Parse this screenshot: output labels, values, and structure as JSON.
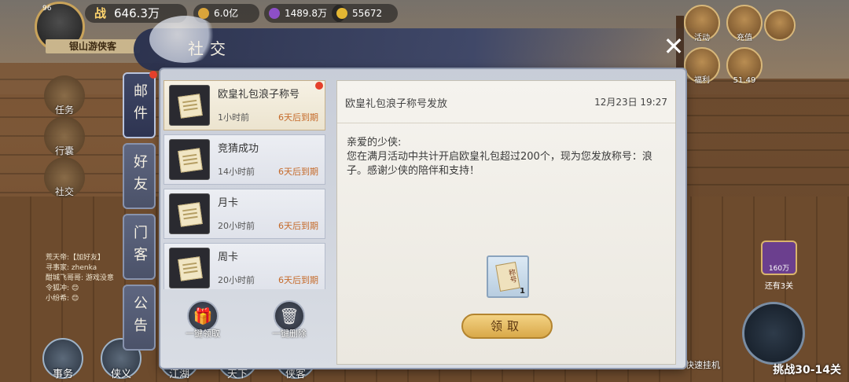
{
  "player": {
    "level": "96",
    "name": "银山游侠客",
    "power_prefix": "战",
    "power": "646.3万"
  },
  "currencies": [
    {
      "icon": "coin-icon",
      "value": "6.0亿",
      "color": "#d9a43a"
    },
    {
      "icon": "gem-icon",
      "value": "1489.8万",
      "color": "#8d4fc8"
    },
    {
      "icon": "ingot-icon",
      "value": "55672",
      "color": "#e4b733"
    }
  ],
  "side_icons": [
    {
      "label": "活动"
    },
    {
      "label": "充值"
    },
    {
      "label": "福利"
    },
    {
      "label": "51.49"
    }
  ],
  "bg_menu": [
    "任务",
    "行囊",
    "社交"
  ],
  "chat_lines": [
    "荒天帝:【加好友】",
    "寻事家: zhenka",
    "酣城飞哥哥: 游戏没意",
    "令狐冲: 😊",
    "小纷希: 😊"
  ],
  "bottom_nav": [
    "事务",
    "侠义",
    "江湖",
    "天下",
    "侠客"
  ],
  "right_bottom": {
    "gift_value": "160万",
    "gift_label": "还有3关",
    "fast_label": "快速挂机",
    "challenge": "挑战30-14关"
  },
  "modal": {
    "title": "社交",
    "tabs": [
      {
        "label": "邮件",
        "active": true,
        "dot": true
      },
      {
        "label": "好友",
        "active": false,
        "dot": false
      },
      {
        "label": "门客",
        "active": false,
        "dot": false
      },
      {
        "label": "公告",
        "active": false,
        "dot": false
      }
    ],
    "mails": [
      {
        "name": "欧皇礼包浪子称号",
        "ago": "1小时前",
        "expire": "6天后到期",
        "unread": true,
        "selected": true
      },
      {
        "name": "竞猜成功",
        "ago": "14小时前",
        "expire": "6天后到期",
        "unread": false,
        "selected": false
      },
      {
        "name": "月卡",
        "ago": "20小时前",
        "expire": "6天后到期",
        "unread": false,
        "selected": false
      },
      {
        "name": "周卡",
        "ago": "20小时前",
        "expire": "6天后到期",
        "unread": false,
        "selected": false
      }
    ],
    "actions": {
      "claim_all": "一键领取",
      "delete_all": "一键删除"
    },
    "detail": {
      "title": "欧皇礼包浪子称号发放",
      "time": "12月23日 19:27",
      "greeting": "亲爱的少侠:",
      "body": "您在满月活动中共计开启欧皇礼包超过200个，现为您发放称号：浪子。感谢少侠的陪伴和支持！",
      "attachment_label": "称号",
      "attachment_count": "1",
      "claim_label": "领取"
    }
  }
}
